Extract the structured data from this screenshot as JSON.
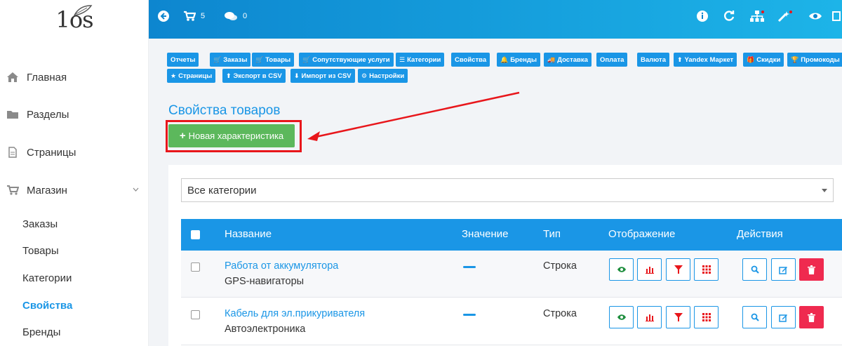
{
  "logo": {
    "text": "1os"
  },
  "sidebar": {
    "items": [
      {
        "label": "Главная",
        "icon": "home-icon"
      },
      {
        "label": "Разделы",
        "icon": "folder-icon"
      },
      {
        "label": "Страницы",
        "icon": "file-icon"
      },
      {
        "label": "Магазин",
        "icon": "cart-icon"
      }
    ],
    "shop_sub": [
      {
        "label": "Заказы",
        "active": false
      },
      {
        "label": "Товары",
        "active": false
      },
      {
        "label": "Категории",
        "active": false
      },
      {
        "label": "Свойства",
        "active": true
      },
      {
        "label": "Бренды",
        "active": false
      }
    ]
  },
  "topbar": {
    "cart_count": "5",
    "comments_count": "0",
    "colors": {
      "from": "#0d86cf",
      "to": "#1db4e8"
    }
  },
  "quick_nav": [
    {
      "label": "Отчеты",
      "icon": ""
    },
    {
      "label": "Заказы",
      "icon": "cart"
    },
    {
      "label": "Товары",
      "icon": "cart"
    },
    {
      "label": "Сопутствующие услуги",
      "icon": "cart"
    },
    {
      "label": "Категории",
      "icon": "list"
    },
    {
      "label": "Свойства",
      "icon": ""
    },
    {
      "label": "Бренды",
      "icon": "bell"
    },
    {
      "label": "Доставка",
      "icon": "truck"
    },
    {
      "label": "Оплата",
      "icon": ""
    },
    {
      "label": "Валюта",
      "icon": ""
    },
    {
      "label": "Yandex Маркет",
      "icon": "upload"
    },
    {
      "label": "Скидки",
      "icon": "gift"
    },
    {
      "label": "Промокоды",
      "icon": "trophy"
    },
    {
      "label": "Страницы",
      "icon": "star"
    },
    {
      "label": "Экспорт в CSV",
      "icon": "upload"
    },
    {
      "label": "Импорт из CSV",
      "icon": "download"
    },
    {
      "label": "Настройки",
      "icon": "gear"
    }
  ],
  "page": {
    "title": "Свойства товаров",
    "new_button": "Новая характеристика",
    "category_select": "Все категории"
  },
  "table": {
    "headers": {
      "name": "Название",
      "value": "Значение",
      "type": "Тип",
      "display": "Отображение",
      "actions": "Действия"
    },
    "rows": [
      {
        "name": "Работа от аккумулятора",
        "category": "GPS-навигаторы",
        "type": "Строка"
      },
      {
        "name": "Кабель для эл.прикуривателя",
        "category": "Автоэлектроника",
        "type": "Строка"
      }
    ]
  },
  "colors": {
    "accent": "#1a96e6",
    "success": "#5cb85c",
    "danger": "#ef2a4f",
    "annotation": "#e8161b"
  }
}
